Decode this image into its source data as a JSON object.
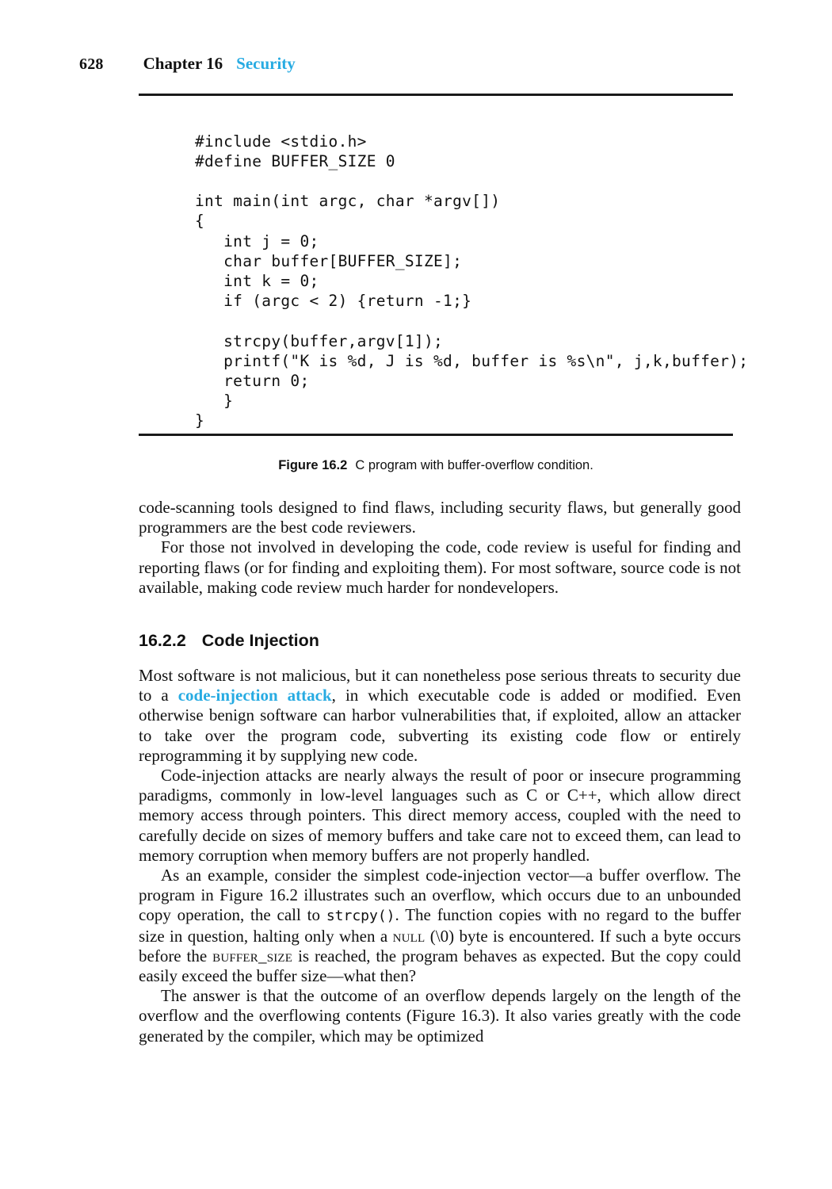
{
  "page": {
    "folio": "628",
    "chapter_label": "Chapter 16",
    "chapter_title": "Security",
    "accent_color": "#27ABE2",
    "text_color": "#111111"
  },
  "figure": {
    "code": "#include <stdio.h>\n#define BUFFER_SIZE 0\n\nint main(int argc, char *argv[])\n{\n   int j = 0;\n   char buffer[BUFFER_SIZE];\n   int k = 0;\n   if (argc < 2) {return -1;}\n\n   strcpy(buffer,argv[1]);\n   printf(\"K is %d, J is %d, buffer is %s\\n\", j,k,buffer);\n   return 0;\n   }\n}",
    "caption_number": "Figure 16.2",
    "caption_text": "C program with buffer-overflow condition."
  },
  "body": {
    "para_1_continued": "code-scanning tools designed to find flaws, including security flaws, but generally good programmers are the best code reviewers.",
    "para_2": "For those not involved in developing the code, code review is useful for finding and reporting flaws (or for finding and exploiting them). For most software, source code is not available, making code review much harder for nondevelopers.",
    "heading_number": "16.2.2",
    "heading_title": "Code Injection",
    "para_3_part_1": "Most software is not malicious, but it can nonetheless pose serious threats to security due to a ",
    "para_3_accent": "code-injection attack",
    "para_3_part_2": ", in which executable code is added or modified. Even otherwise benign software can harbor vulnerabilities that, if exploited, allow an attacker to take over the program code, subverting its existing code flow or entirely reprogramming it by supplying new code.",
    "para_4": "Code-injection attacks are nearly always the result of poor or insecure programming paradigms, commonly in low-level languages such as C or C++, which allow direct memory access through pointers. This direct memory access, coupled with the need to carefully decide on sizes of memory buffers and take care not to exceed them, can lead to memory corruption when memory buffers are not properly handled.",
    "para_5_part_1": "As an example, consider the simplest code-injection vector—a buffer overflow. The program in Figure 16.2 illustrates such an overflow, which occurs due to an unbounded copy operation, the call to ",
    "para_5_mono": "strcpy()",
    "para_5_part_2": ". The function copies with no regard to the buffer size in question, halting only when a ",
    "para_5_smallcaps_1": "null",
    "para_5_part_3": " (\\0) byte is encountered. If such a byte occurs before the ",
    "para_5_smallcaps_2": "buffer_size",
    "para_5_part_4": " is reached, the program behaves as expected. But the copy could easily exceed the buffer size—what then?",
    "para_6": "The answer is that the outcome of an overflow depends largely on the length of the overflow and the overflowing contents (Figure 16.3). It also varies greatly with the code generated by the compiler, which may be optimized"
  }
}
